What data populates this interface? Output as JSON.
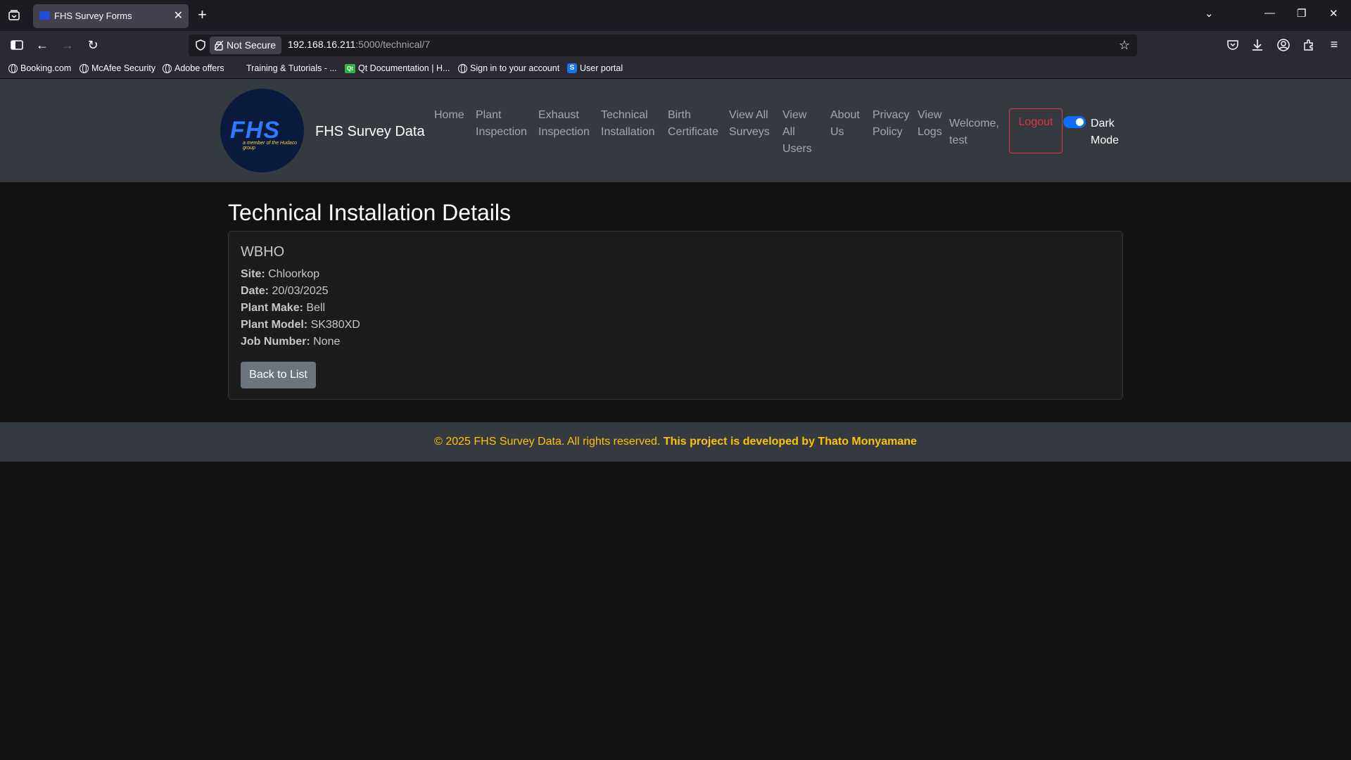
{
  "browser": {
    "tab_title": "FHS Survey Forms",
    "security_label": "Not Secure",
    "url_host": "192.168.16.211",
    "url_path": ":5000/technical/7",
    "bookmarks": [
      {
        "label": "Booking.com",
        "icon": "globe-icon"
      },
      {
        "label": "McAfee Security",
        "icon": "globe-icon"
      },
      {
        "label": "Adobe offers",
        "icon": "globe-icon"
      },
      {
        "label": "Training & Tutorials - ...",
        "icon": "none"
      },
      {
        "label": "Qt Documentation | H...",
        "icon": "qt-icon"
      },
      {
        "label": "Sign in to your account",
        "icon": "globe-icon"
      },
      {
        "label": "User portal",
        "icon": "sharepoint-icon"
      }
    ]
  },
  "site": {
    "logo_mark": "FHS",
    "logo_sub": "a member of the Hudaco group",
    "brand": "FHS Survey Data",
    "nav": [
      {
        "label": "Home"
      },
      {
        "label": "Plant Inspection"
      },
      {
        "label": "Exhaust Inspection"
      },
      {
        "label": "Technical Installation"
      },
      {
        "label": "Birth Certificate"
      },
      {
        "label": "View All Surveys"
      },
      {
        "label": "View All Users"
      },
      {
        "label": "About Us"
      },
      {
        "label": "Privacy Policy"
      },
      {
        "label": "View Logs"
      }
    ],
    "welcome": "Welcome, test",
    "logout": "Logout",
    "dark_mode_label": "Dark Mode",
    "dark_mode_on": true
  },
  "main": {
    "title": "Technical Installation Details",
    "card_title": "WBHO",
    "details": [
      {
        "label": "Site:",
        "value": "Chloorkop"
      },
      {
        "label": "Date:",
        "value": "20/03/2025"
      },
      {
        "label": "Plant Make:",
        "value": "Bell"
      },
      {
        "label": "Plant Model:",
        "value": "SK380XD"
      },
      {
        "label": "Job Number:",
        "value": "None"
      }
    ],
    "back_button": "Back to List"
  },
  "footer": {
    "copyright": "© 2025 FHS Survey Data. All rights reserved.",
    "developer": "This project is developed by Thato Monyamane"
  },
  "colors": {
    "accent": "#0d6efd",
    "danger": "#dc3545",
    "footer_text": "#ffc107",
    "navbar_bg": "#343a40",
    "page_bg": "#121212"
  }
}
